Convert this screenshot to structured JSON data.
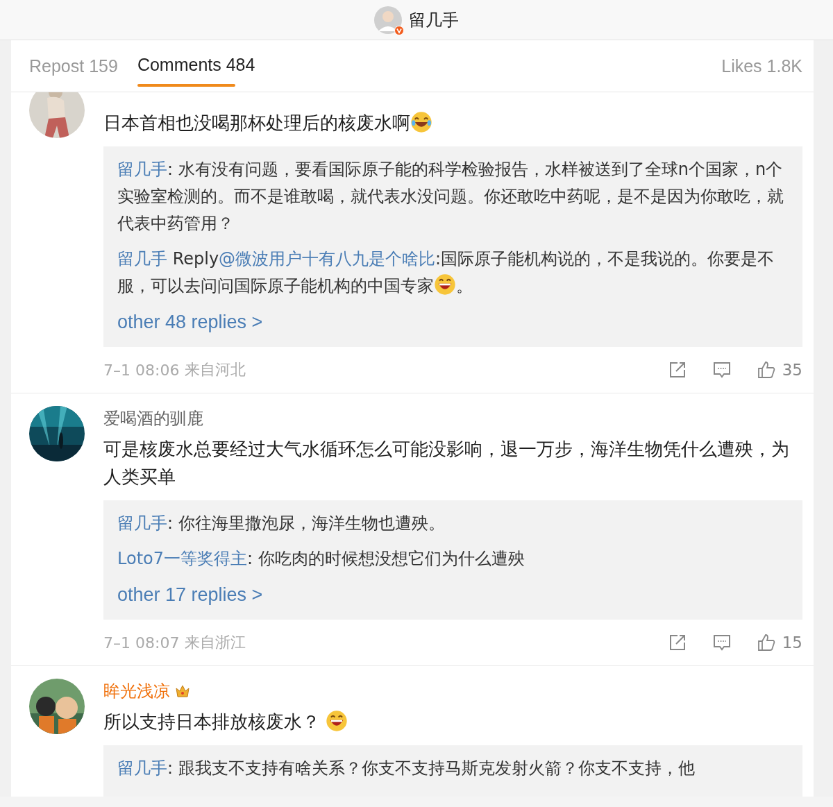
{
  "header": {
    "name": "留几手",
    "verified": true
  },
  "tabs": [
    {
      "label": "Repost 159",
      "selected": false
    },
    {
      "label": "Comments 484",
      "selected": true
    }
  ],
  "likes_tab": "Likes 1.8K",
  "comments": [
    {
      "avatar": {
        "kind": "picture"
      },
      "text": [
        {
          "kind": "text",
          "text": "日本首相也没喝那杯处理后的核废水啊"
        },
        {
          "kind": "emoji_tears"
        }
      ],
      "replies": [
        [
          {
            "kind": "link",
            "text": "留几手"
          },
          {
            "kind": "text",
            "text": ": 水有没有问题，要看国际原子能的科学检验报告，水样被送到了全球n个国家，n个实验室检测的。而不是谁敢喝，就代表水没问题。你还敢吃中药呢，是不是因为你敢吃，就代表中药管用？"
          }
        ],
        [
          {
            "kind": "link",
            "text": "留几手"
          },
          {
            "kind": "text",
            "text": " Reply"
          },
          {
            "kind": "link",
            "text": "@微波用户十有八九是个啥比"
          },
          {
            "kind": "text",
            "text": ":国际原子能机构说的，不是我说的。你要是不服，可以去问问国际原子能机构的中国专家"
          },
          {
            "kind": "emoji_grin"
          },
          {
            "kind": "text",
            "text": "。"
          }
        ]
      ],
      "more": "other 48 replies >",
      "time": "7–1 08:06",
      "location": "来自河北",
      "likes": "35"
    },
    {
      "avatar": {
        "kind": "picture"
      },
      "author": "爱喝酒的驯鹿",
      "vip": false,
      "text": [
        {
          "kind": "text",
          "text": "可是核废水总要经过大气水循环怎么可能没影响，退一万步，海洋生物凭什么遭殃，为人类买单"
        }
      ],
      "replies": [
        [
          {
            "kind": "link",
            "text": "留几手"
          },
          {
            "kind": "text",
            "text": ": 你往海里撒泡尿，海洋生物也遭殃。"
          }
        ],
        [
          {
            "kind": "link",
            "text": "Loto7一等奖得主"
          },
          {
            "kind": "text",
            "text": ": 你吃肉的时候想没想它们为什么遭殃"
          }
        ]
      ],
      "more": "other 17 replies >",
      "time": "7–1 08:07",
      "location": "来自浙江",
      "likes": "15"
    },
    {
      "avatar": {
        "kind": "picture"
      },
      "author": "眸光浅凉",
      "vip": true,
      "text": [
        {
          "kind": "text",
          "text": "所以支持日本排放核废水？ "
        },
        {
          "kind": "emoji_grin"
        }
      ],
      "replies": [
        [
          {
            "kind": "link",
            "text": "留几手"
          },
          {
            "kind": "text",
            "text": ": 跟我支不支持有啥关系？你支不支持马斯克发射火箭？你支不支持，他"
          }
        ]
      ]
    }
  ]
}
